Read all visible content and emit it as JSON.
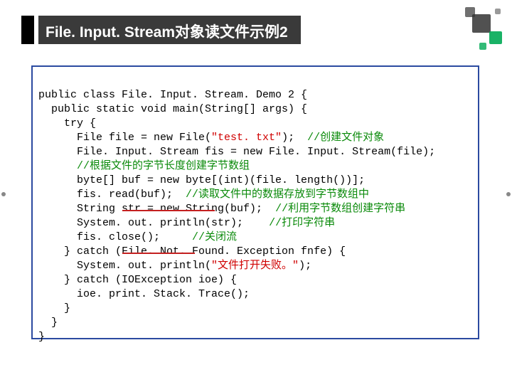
{
  "title": "File. Input. Stream对象读文件示例2",
  "code": {
    "l1": "public class File. Input. Stream. Demo 2 {",
    "l2": "  public static void main(String[] args) {",
    "l3": "    try {",
    "l4a": "      File file = new File(",
    "l4s": "\"test. txt\"",
    "l4b": ");  ",
    "l4c": "//创建文件对象",
    "l5": "      File. Input. Stream fis = new File. Input. Stream(file);",
    "l6": "      ",
    "l6c": "//根据文件的字节长度创建字节数组",
    "l7": "      byte[] buf = new byte[(int)(file. length())];",
    "l8a": "      fis. read(buf);  ",
    "l8c": "//读取文件中的数据存放到字节数组中",
    "l9a": "      String str = new String(buf);  ",
    "l9c": "//利用字节数组创建字符串",
    "l10a": "      System. out. println(str);    ",
    "l10c": "//打印字符串",
    "l11a": "      fis. close();     ",
    "l11c": "//关闭流",
    "l12": "    } catch (File. Not. Found. Exception fnfe) {",
    "l13a": "      System. out. println(",
    "l13s": "\"文件打开失败。\"",
    "l13b": ");",
    "l14": "    } catch (IOException ioe) {",
    "l15": "      ioe. print. Stack. Trace();",
    "l16": "    }",
    "l17": "  }",
    "l18": "}"
  }
}
